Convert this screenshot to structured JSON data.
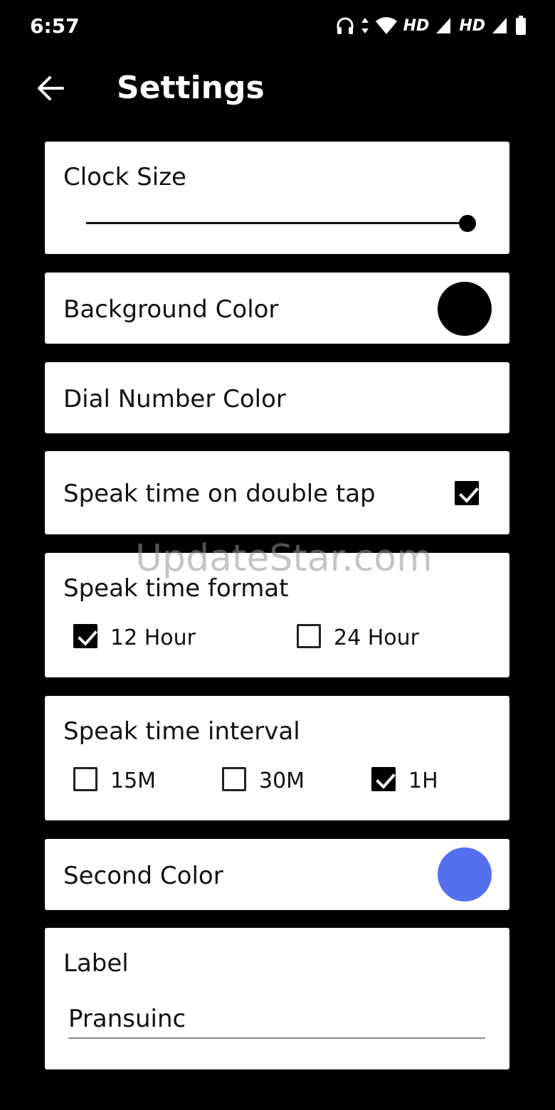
{
  "status_bar": {
    "time": "6:57",
    "net1": "HD",
    "net2": "HD"
  },
  "app_bar": {
    "title": "Settings"
  },
  "clock_size": {
    "label": "Clock Size",
    "value_fraction": 1.0
  },
  "background_color": {
    "label": "Background Color",
    "color": "#000000"
  },
  "dial_number_color": {
    "label": "Dial Number Color"
  },
  "speak_double_tap": {
    "label": "Speak time on double tap",
    "checked": true
  },
  "speak_format": {
    "label": "Speak time format",
    "options": [
      {
        "label": "12 Hour",
        "checked": true
      },
      {
        "label": "24 Hour",
        "checked": false
      }
    ]
  },
  "speak_interval": {
    "label": "Speak time interval",
    "options": [
      {
        "label": "15M",
        "checked": false
      },
      {
        "label": "30M",
        "checked": false
      },
      {
        "label": "1H",
        "checked": true
      }
    ]
  },
  "second_color": {
    "label": "Second Color",
    "color": "#5470EE"
  },
  "label_field": {
    "label": "Label",
    "value": "Pransuinc"
  },
  "watermark": "UpdateStar.com"
}
